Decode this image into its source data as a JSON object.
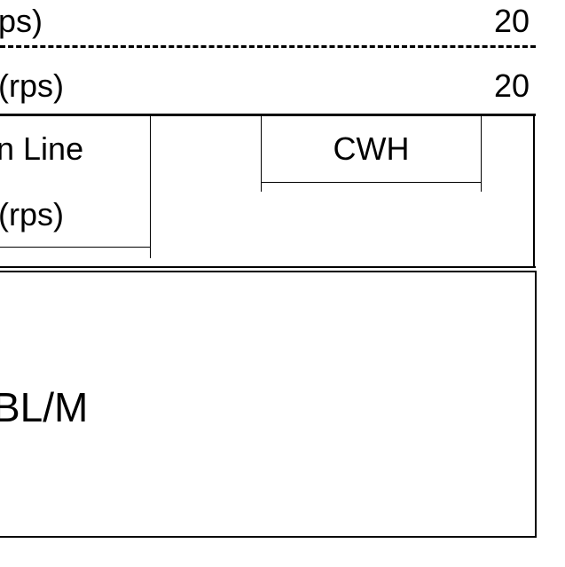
{
  "rows": [
    {
      "label": "ps)",
      "value": "20"
    },
    {
      "label": "(rps)",
      "value": "20"
    }
  ],
  "upper_panel": {
    "left_box": {
      "title": "n Line",
      "unit": "(rps)"
    },
    "cwh_box": {
      "label": "CWH"
    }
  },
  "lower_panel": {
    "label": "BL/M"
  },
  "colors": {
    "background": "#ffffff",
    "foreground": "#000000"
  }
}
